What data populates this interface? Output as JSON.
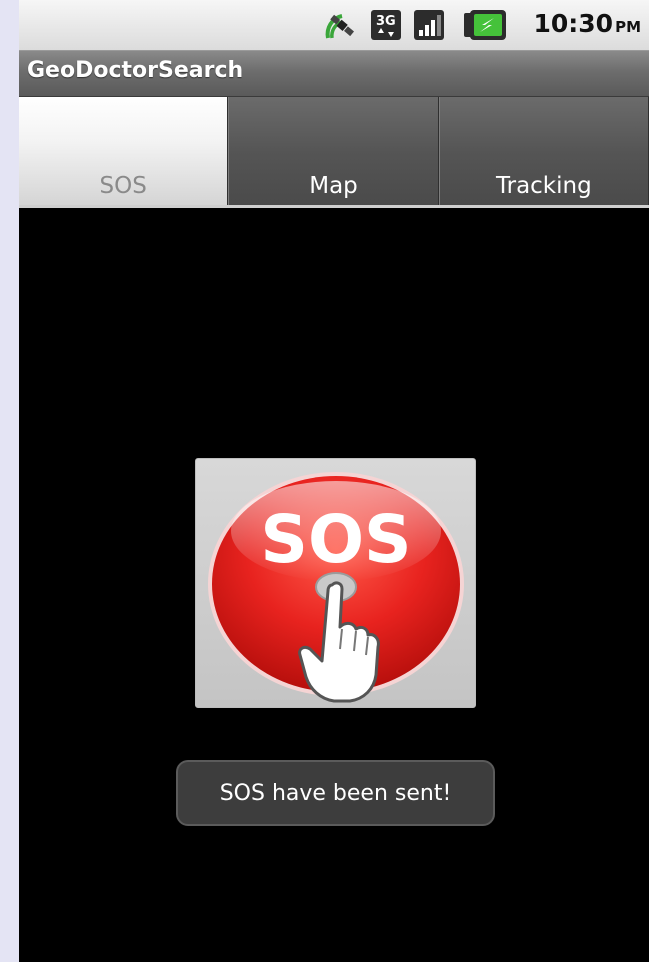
{
  "status_bar": {
    "time": "10:30",
    "ampm": "PM",
    "icons": [
      "gps-satellite-icon",
      "3g-data-icon",
      "signal-strength-icon",
      "battery-charging-icon"
    ],
    "network_label": "3G"
  },
  "app": {
    "title": "GeoDoctorSearch"
  },
  "tabs": [
    {
      "label": "SOS",
      "selected": true
    },
    {
      "label": "Map",
      "selected": false
    },
    {
      "label": "Tracking",
      "selected": false
    }
  ],
  "sos_button": {
    "label": "SOS",
    "icon": "hand-press-icon",
    "color": "#e8231f"
  },
  "toast": {
    "message": "SOS have been sent!"
  }
}
